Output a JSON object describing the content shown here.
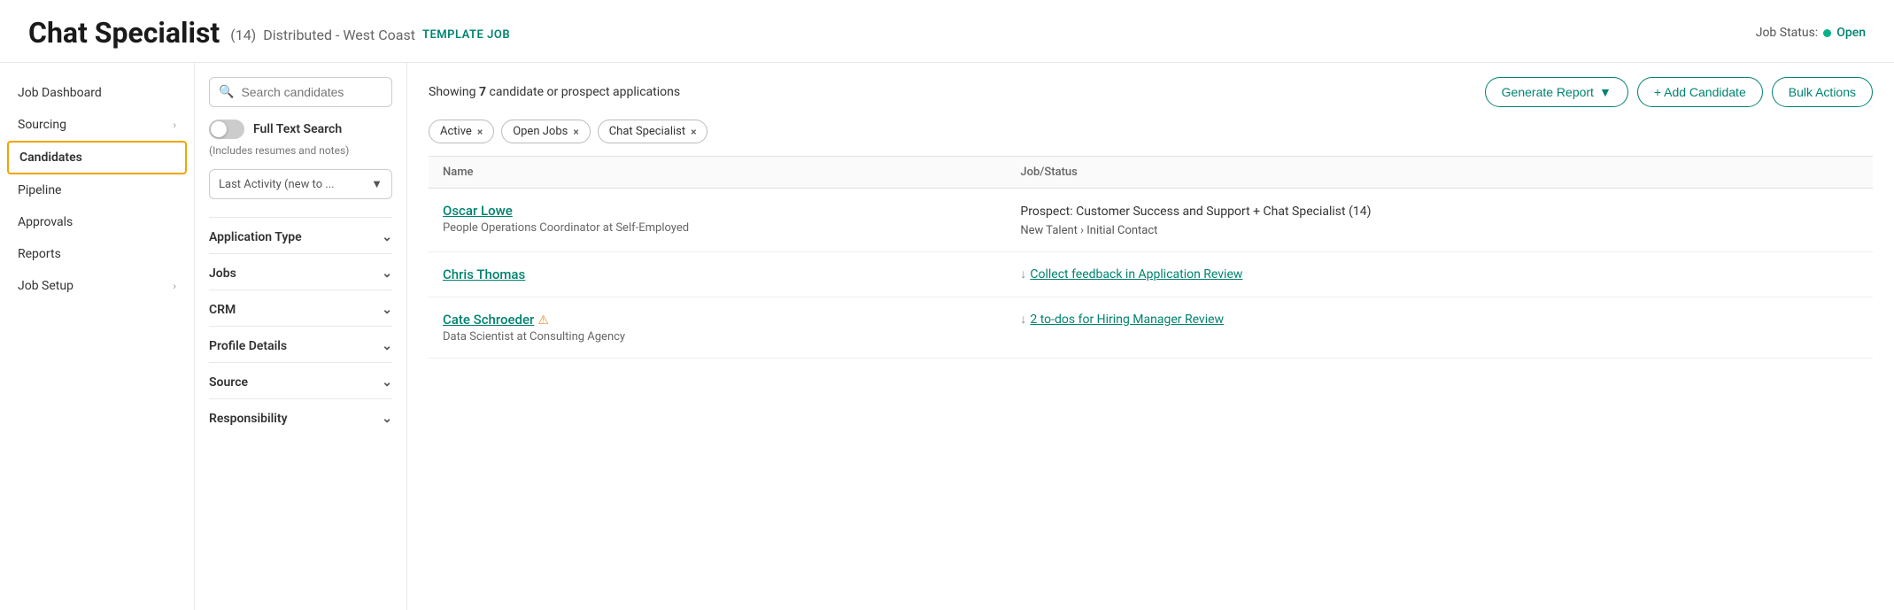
{
  "header": {
    "title": "Chat Specialist",
    "count": "(14)",
    "location": "Distributed - West Coast",
    "template_badge": "TEMPLATE JOB",
    "job_status_label": "Job Status:",
    "job_status_dot_color": "#00b388",
    "job_status_value": "Open"
  },
  "sidebar": {
    "items": [
      {
        "id": "job-dashboard",
        "label": "Job Dashboard",
        "has_chevron": false
      },
      {
        "id": "sourcing",
        "label": "Sourcing",
        "has_chevron": true
      },
      {
        "id": "candidates",
        "label": "Candidates",
        "has_chevron": false,
        "active": true
      },
      {
        "id": "pipeline",
        "label": "Pipeline",
        "has_chevron": false
      },
      {
        "id": "approvals",
        "label": "Approvals",
        "has_chevron": false
      },
      {
        "id": "reports",
        "label": "Reports",
        "has_chevron": false
      },
      {
        "id": "job-setup",
        "label": "Job Setup",
        "has_chevron": true
      }
    ]
  },
  "filter_panel": {
    "search_placeholder": "Search candidates",
    "full_text_label": "Full Text Search",
    "full_text_hint": "(Includes resumes and notes)",
    "sort_label": "Last Activity (new to ...",
    "sections": [
      {
        "id": "application-type",
        "label": "Application Type"
      },
      {
        "id": "jobs",
        "label": "Jobs"
      },
      {
        "id": "crm",
        "label": "CRM"
      },
      {
        "id": "profile-details",
        "label": "Profile Details"
      },
      {
        "id": "source",
        "label": "Source"
      },
      {
        "id": "responsibility",
        "label": "Responsibility"
      }
    ]
  },
  "main": {
    "results_text": "Showing",
    "results_count": "7",
    "results_suffix": "candidate or prospect applications",
    "filter_tags": [
      {
        "id": "active",
        "label": "Active"
      },
      {
        "id": "open-jobs",
        "label": "Open Jobs"
      },
      {
        "id": "chat-specialist",
        "label": "Chat Specialist"
      }
    ],
    "buttons": {
      "generate_report": "Generate Report",
      "add_candidate": "+ Add Candidate",
      "bulk_actions": "Bulk Actions"
    },
    "table_headers": [
      {
        "id": "name",
        "label": "Name"
      },
      {
        "id": "job-status",
        "label": "Job/Status"
      }
    ],
    "candidates": [
      {
        "id": "oscar-lowe",
        "name": "Oscar Lowe",
        "sub": "People Operations Coordinator at Self-Employed",
        "job_status": "Prospect: Customer Success and Support + Chat Specialist (14)",
        "stage": "New Talent › Initial Contact",
        "action_link": null,
        "warning": false
      },
      {
        "id": "chris-thomas",
        "name": "Chris Thomas",
        "sub": "",
        "job_status": "",
        "stage": "",
        "action_link": "Collect feedback in Application Review",
        "warning": false
      },
      {
        "id": "cate-schroeder",
        "name": "Cate Schroeder",
        "sub": "Data Scientist at Consulting Agency",
        "job_status": "",
        "stage": "",
        "action_link": "2 to-dos for Hiring Manager Review",
        "warning": true
      }
    ]
  }
}
